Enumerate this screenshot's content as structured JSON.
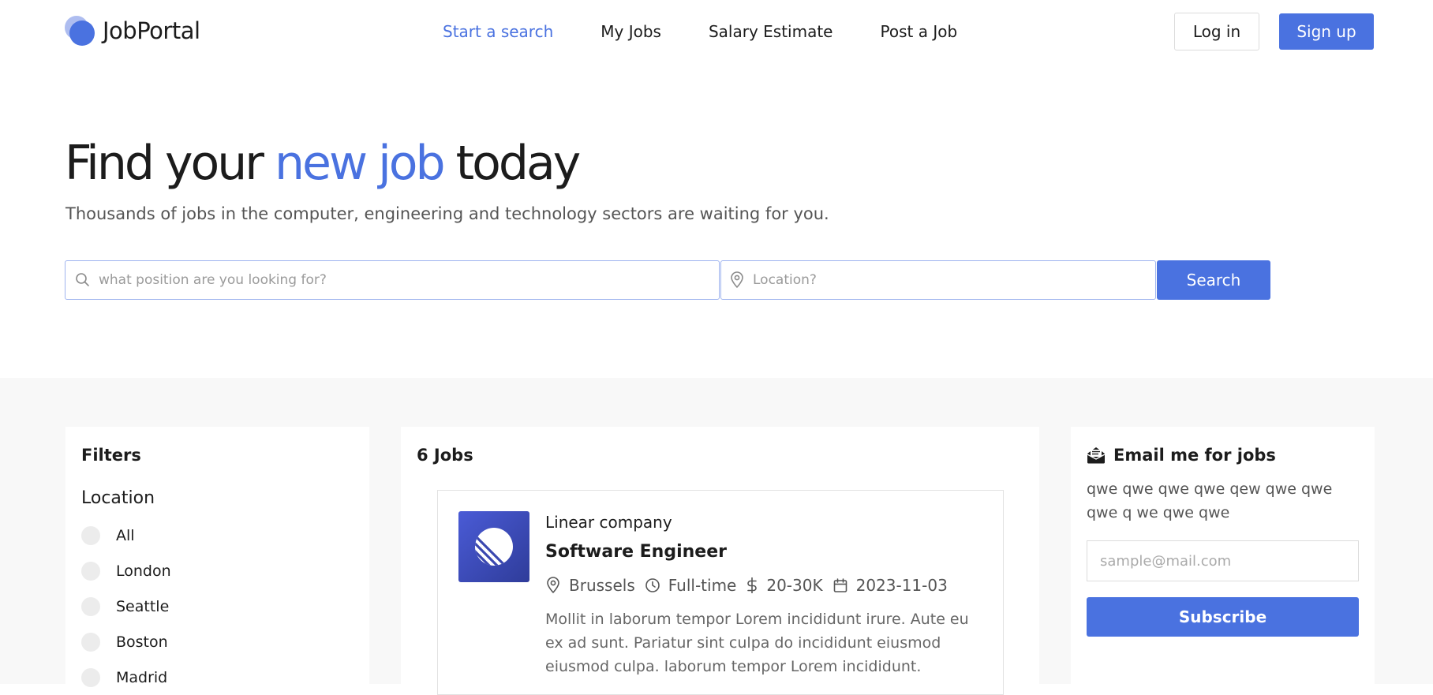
{
  "brand": {
    "name": "JobPortal",
    "accent_color": "#4a72e0"
  },
  "nav": {
    "links": [
      {
        "label": "Start a search",
        "active": true
      },
      {
        "label": "My Jobs",
        "active": false
      },
      {
        "label": "Salary Estimate",
        "active": false
      },
      {
        "label": "Post a Job",
        "active": false
      }
    ],
    "login_label": "Log in",
    "signup_label": "Sign up"
  },
  "hero": {
    "title_pre": "Find your ",
    "title_accent": "new job",
    "title_post": " today",
    "subtitle": "Thousands of jobs in the computer, engineering and technology sectors are waiting for you."
  },
  "search": {
    "query_placeholder": "what position are you looking for?",
    "query_value": "",
    "location_placeholder": "Location?",
    "location_value": "",
    "button_label": "Search",
    "search_icon": "search-icon",
    "location_icon": "map-pin-icon"
  },
  "filters": {
    "title": "Filters",
    "location_title": "Location",
    "options": [
      "All",
      "London",
      "Seattle",
      "Boston",
      "Madrid"
    ]
  },
  "jobs": {
    "count_label": "6 Jobs",
    "items": [
      {
        "company": "Linear company",
        "title": "Software Engineer",
        "location": "Brussels",
        "type": "Full-time",
        "salary": "20-30K",
        "date": "2023-11-03",
        "description": "Mollit in laborum tempor Lorem incididunt irure. Aute eu ex ad sunt. Pariatur sint culpa do incididunt eiusmod eiusmod culpa. laborum tempor Lorem incididunt."
      }
    ]
  },
  "email_panel": {
    "title": "Email me for jobs",
    "icon": "envelope-open-icon",
    "description": "qwe qwe qwe qwe qew qwe qwe qwe q we qwe qwe",
    "input_placeholder": "sample@mail.com",
    "input_value": "",
    "button_label": "Subscribe"
  }
}
